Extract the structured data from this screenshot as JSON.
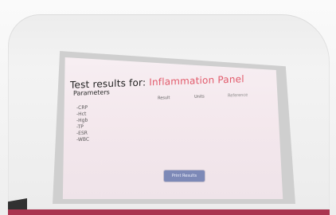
{
  "screen": {
    "title_prefix": "Test results for:",
    "title_panel": "Inflammation Panel",
    "section_label": "Parameters",
    "columns": {
      "result": "Result",
      "units": "Units",
      "reference": "Reference"
    },
    "rows": [
      {
        "param": "-CRP",
        "result": "",
        "units": "",
        "reference": ""
      },
      {
        "param": "-Hct",
        "result": "",
        "units": "",
        "reference": ""
      },
      {
        "param": "-Hgb",
        "result": "",
        "units": "",
        "reference": ""
      },
      {
        "param": "-TP",
        "result": "",
        "units": "",
        "reference": ""
      },
      {
        "param": "-ESR",
        "result": "",
        "units": "",
        "reference": ""
      },
      {
        "param": "-WBC",
        "result": "",
        "units": "",
        "reference": ""
      }
    ],
    "print_button_label": "Print Results"
  },
  "colors": {
    "accent": "#e25a6b",
    "button": "#7d89b7",
    "bottom_bar": "#a9344f"
  }
}
